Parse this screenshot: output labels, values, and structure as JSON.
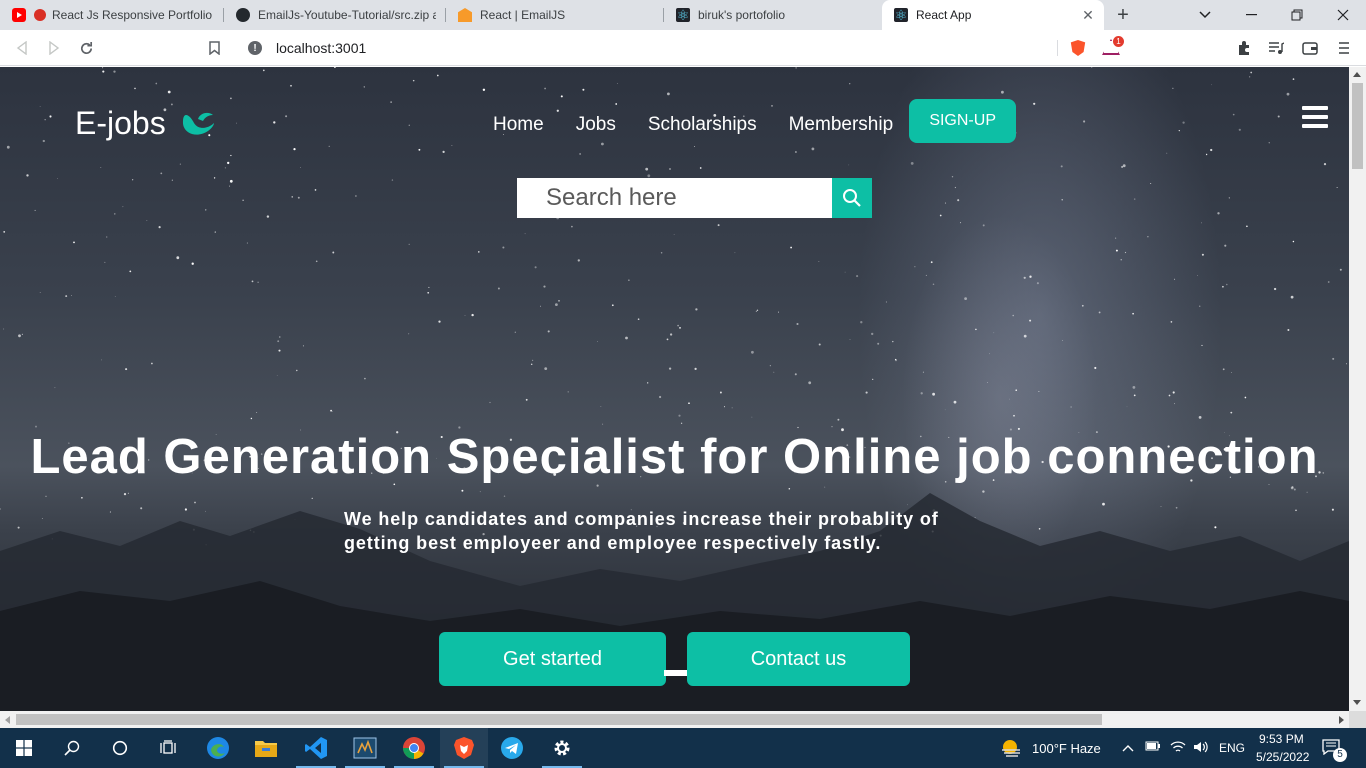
{
  "browser": {
    "tabs": [
      {
        "title": "React Js Responsive Portfolio w",
        "favicon": "youtube-icon",
        "recording": true
      },
      {
        "title": "EmailJs-Youtube-Tutorial/src.zip at",
        "favicon": "github-icon"
      },
      {
        "title": "React | EmailJS",
        "favicon": "emailjs-icon"
      },
      {
        "title": "biruk's portofolio",
        "favicon": "react-icon"
      },
      {
        "title": "React App",
        "favicon": "react-icon",
        "active": true
      }
    ],
    "url": "localhost:3001",
    "rewards_badge": "1"
  },
  "page": {
    "logo_text": "E-jobs",
    "nav": [
      "Home",
      "Jobs",
      "Scholarships",
      "Membership"
    ],
    "signup_label": "SIGN-UP",
    "search_placeholder": "Search here",
    "headline": "Lead Generation Specialist for Online job connection",
    "subline_1": "We help candidates and companies increase their probablity of",
    "subline_2": "getting best employeer and employee respectively fastly.",
    "cta_primary": "Get started",
    "cta_secondary": "Contact us",
    "colors": {
      "accent": "#0dbfa5",
      "text": "#ffffff"
    }
  },
  "taskbar": {
    "weather": "100°F  Haze",
    "language": "ENG",
    "time": "9:53 PM",
    "date": "5/25/2022",
    "notifications": "5"
  }
}
